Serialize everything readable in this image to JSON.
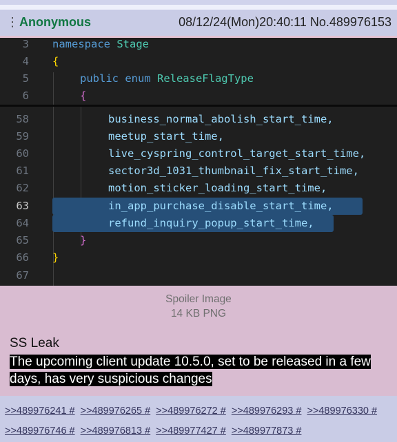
{
  "post": {
    "name": "Anonymous",
    "datetime": "08/12/24(Mon)20:40:11",
    "number": "No.489976153",
    "menu_icon": "vertical-dots-icon"
  },
  "code_image": {
    "top_lines": [
      {
        "n": "3",
        "text": "namespace Stage"
      },
      {
        "n": "4",
        "text": "{"
      },
      {
        "n": "5",
        "text": "public enum ReleaseFlagType"
      },
      {
        "n": "6",
        "text": "{"
      }
    ],
    "lines": [
      {
        "n": "58",
        "text": "business_normal_abolish_start_time,"
      },
      {
        "n": "59",
        "text": "meetup_start_time,"
      },
      {
        "n": "60",
        "text": "live_cyspring_control_target_start_time,"
      },
      {
        "n": "61",
        "text": "sector3d_1031_thumbnail_fix_start_time,"
      },
      {
        "n": "62",
        "text": "motion_sticker_loading_start_time,"
      },
      {
        "n": "63",
        "text": "in_app_purchase_disable_start_time,"
      },
      {
        "n": "64",
        "text": "refund_inquiry_popup_start_time,"
      },
      {
        "n": "65",
        "text": "}"
      },
      {
        "n": "66",
        "text": "}"
      },
      {
        "n": "67",
        "text": ""
      }
    ]
  },
  "file": {
    "label": "Spoiler Image",
    "info": "14 KB PNG"
  },
  "subject": "SS Leak",
  "comment": "The upcoming client update 10.5.0, set to be released in a few days, has very suspicious changes",
  "replies": [
    ">>489976241 #",
    ">>489976265 #",
    ">>489976272 #",
    ">>489976293 #",
    ">>489976330 #",
    ">>489976746 #",
    ">>489976813 #",
    ">>489977427 #",
    ">>489977873 #"
  ]
}
